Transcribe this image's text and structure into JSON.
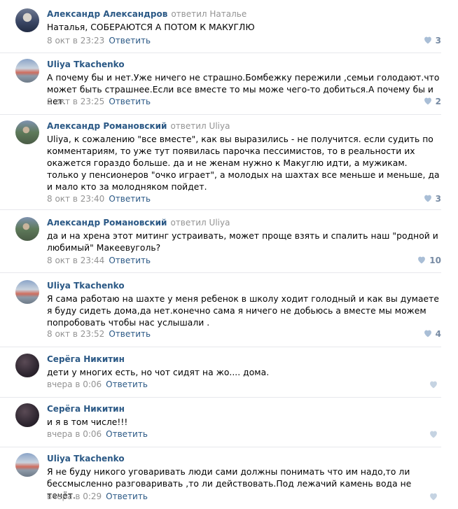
{
  "icons": {
    "like": "heart-icon"
  },
  "colors": {
    "link": "#2a5885",
    "muted": "#939393",
    "like": "#768aa3"
  },
  "comments": [
    {
      "author": "Александр Александров",
      "replied": "ответил Наталье",
      "text": "Наталья, СОБЕРАЮТСЯ А ПОТОМ К МАКУГЛЮ",
      "date": "8 окт в 23:23",
      "reply": "Ответить",
      "likes": "3"
    },
    {
      "author": "Uliya Tkachenko",
      "replied": "",
      "text": "А почему бы и нет.Уже ничего не страшно.Бомбежку пережили ,семьи голодают.что может быть страшнее.Если все вместе то мы може чего-то добиться.А почему бы и нет.",
      "date": "8 окт в 23:25",
      "reply": "Ответить",
      "likes": "2"
    },
    {
      "author": "Александр Романовский",
      "replied": "ответил Uliya",
      "text": "Uliya, к сожалению \"все вместе\", как вы выразились - не получится. если судить по комментариям, то уже тут появилась парочка пессимистов, то в реальности их окажется гораздо больше. да и не женам нужно к Макуглю идти, а мужикам. только у пенсионеров \"очко играет\", а молодых на шахтах все меньше и меньше, да и мало кто за молодняком пойдет.",
      "date": "8 окт в 23:40",
      "reply": "Ответить",
      "likes": "3"
    },
    {
      "author": "Александр Романовский",
      "replied": "ответил Uliya",
      "text": "да и на хрена этот митинг устраивать, может проще взять и спалить наш \"родной и любимый\" Макеевуголь?",
      "date": "8 окт в 23:44",
      "reply": "Ответить",
      "likes": "10"
    },
    {
      "author": "Uliya Tkachenko",
      "replied": "",
      "text": "Я сама работаю на шахте у меня ребенок в школу ходит голодный и как вы думаете я буду сидеть дома,да нет.конечно сама я ничего не добьюсь а вместе мы можем попробовать чтобы нас услышали .",
      "date": "8 окт в 23:52",
      "reply": "Ответить",
      "likes": "4"
    },
    {
      "author": "Серёга Никитин",
      "replied": "",
      "text": "дети у многих есть, но чот сидят на жо.... дома.",
      "date": "вчера в 0:06",
      "reply": "Ответить",
      "likes": ""
    },
    {
      "author": "Серёга Никитин",
      "replied": "",
      "text": "и я в том числе!!!",
      "date": "вчера в 0:06",
      "reply": "Ответить",
      "likes": ""
    },
    {
      "author": "Uliya Tkachenko",
      "replied": "",
      "text": "Я не буду никого уговаривать люди сами должны понимать что им надо,то ли бессмысленно разговаривать ,то ли действовать.Под лежачий камень вода не течёт.",
      "date": "вчера в 0:29",
      "reply": "Ответить",
      "likes": ""
    }
  ]
}
